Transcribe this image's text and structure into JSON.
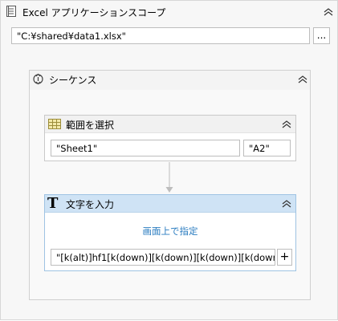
{
  "excel_scope": {
    "title": "Excel アプリケーションスコープ",
    "file_path": "\"C:¥shared¥data1.xlsx\"",
    "browse_label": "..."
  },
  "sequence": {
    "title": "シーケンス"
  },
  "select_range": {
    "title": "範囲を選択",
    "sheet": "\"Sheet1\"",
    "cell": "\"A2\""
  },
  "type_into": {
    "title": "文字を入力",
    "indicate_label": "画面上で指定",
    "text_value": "\"[k(alt)]hf1[k(down)][k(down)][k(down)][k(down)][",
    "plus_label": "+"
  },
  "colors": {
    "active_header": "#cfe3f5",
    "link": "#2a7cc0"
  },
  "icons": [
    "excel-scope-icon",
    "sequence-icon",
    "select-range-icon",
    "type-into-icon",
    "chevron-up-icon",
    "arrow-down-icon"
  ]
}
